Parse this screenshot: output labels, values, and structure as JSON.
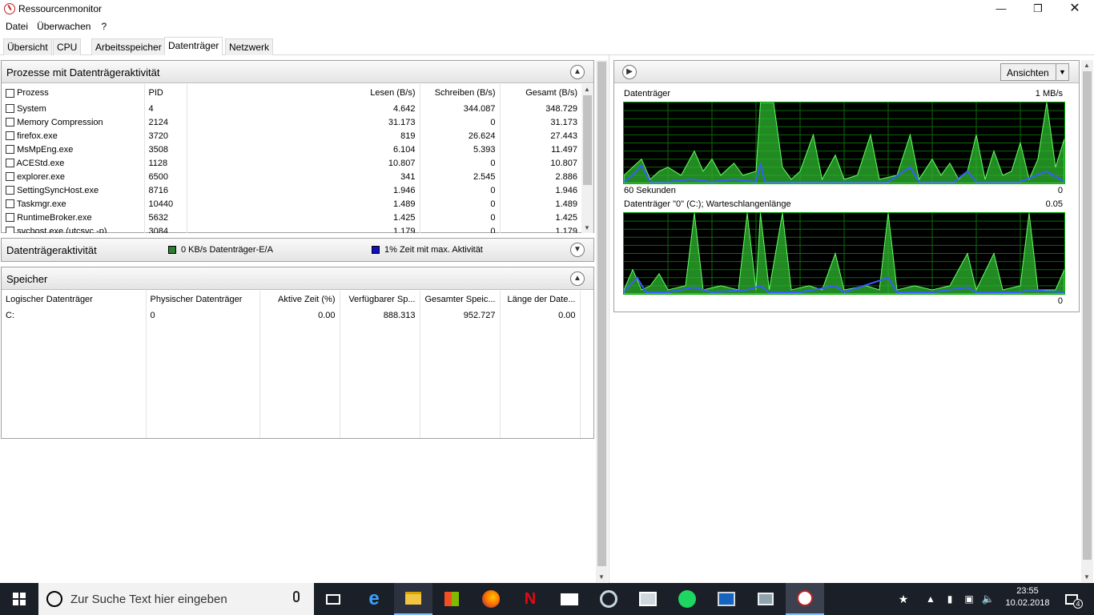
{
  "window": {
    "title": "Ressourcenmonitor"
  },
  "menu": [
    "Datei",
    "Überwachen",
    "?"
  ],
  "tabs": [
    {
      "label": "Übersicht",
      "active": false
    },
    {
      "label": "CPU",
      "active": false
    },
    {
      "label": "Arbeitsspeicher",
      "active": false
    },
    {
      "label": "Datenträger",
      "active": true
    },
    {
      "label": "Netzwerk",
      "active": false
    }
  ],
  "processes": {
    "title": "Prozesse mit Datenträgeraktivität",
    "columns": [
      "Prozess",
      "PID",
      "Lesen (B/s)",
      "Schreiben (B/s)",
      "Gesamt (B/s)"
    ],
    "rows": [
      [
        "System",
        "4",
        "4.642",
        "344.087",
        "348.729"
      ],
      [
        "Memory Compression",
        "2124",
        "31.173",
        "0",
        "31.173"
      ],
      [
        "firefox.exe",
        "3720",
        "819",
        "26.624",
        "27.443"
      ],
      [
        "MsMpEng.exe",
        "3508",
        "6.104",
        "5.393",
        "11.497"
      ],
      [
        "ACEStd.exe",
        "1128",
        "10.807",
        "0",
        "10.807"
      ],
      [
        "explorer.exe",
        "6500",
        "341",
        "2.545",
        "2.886"
      ],
      [
        "SettingSyncHost.exe",
        "8716",
        "1.946",
        "0",
        "1.946"
      ],
      [
        "Taskmgr.exe",
        "10440",
        "1.489",
        "0",
        "1.489"
      ],
      [
        "RuntimeBroker.exe",
        "5632",
        "1.425",
        "0",
        "1.425"
      ],
      [
        "svchost.exe (utcsvc -p)",
        "3084",
        "1.179",
        "0",
        "1.179"
      ]
    ]
  },
  "activity": {
    "title": "Datenträgeraktivität",
    "io_label": "0 KB/s Datenträger-E/A",
    "time_label": "1% Zeit mit max. Aktivität",
    "io_color": "#2e7d32",
    "time_color": "#1010c0"
  },
  "storage": {
    "title": "Speicher",
    "columns": [
      "Logischer Datenträger",
      "Physischer Datenträger",
      "Aktive Zeit (%)",
      "Verfügbarer Sp...",
      "Gesamter Speic...",
      "Länge der Date..."
    ],
    "rows": [
      [
        "C:",
        "0",
        "0.00",
        "888.313",
        "952.727",
        "0.00"
      ]
    ]
  },
  "right": {
    "views_button": "Ansichten",
    "graph1": {
      "title": "Datenträger",
      "max": "1 MB/s",
      "time": "60 Sekunden",
      "min": "0"
    },
    "graph2": {
      "title": "Datenträger \"0\" (C:); Warteschlangenlänge",
      "max": "0.05",
      "min": "0"
    }
  },
  "taskbar": {
    "search_placeholder": "Zur Suche Text hier eingeben",
    "time": "23:55",
    "date": "10.02.2018",
    "notifications": "4"
  }
}
